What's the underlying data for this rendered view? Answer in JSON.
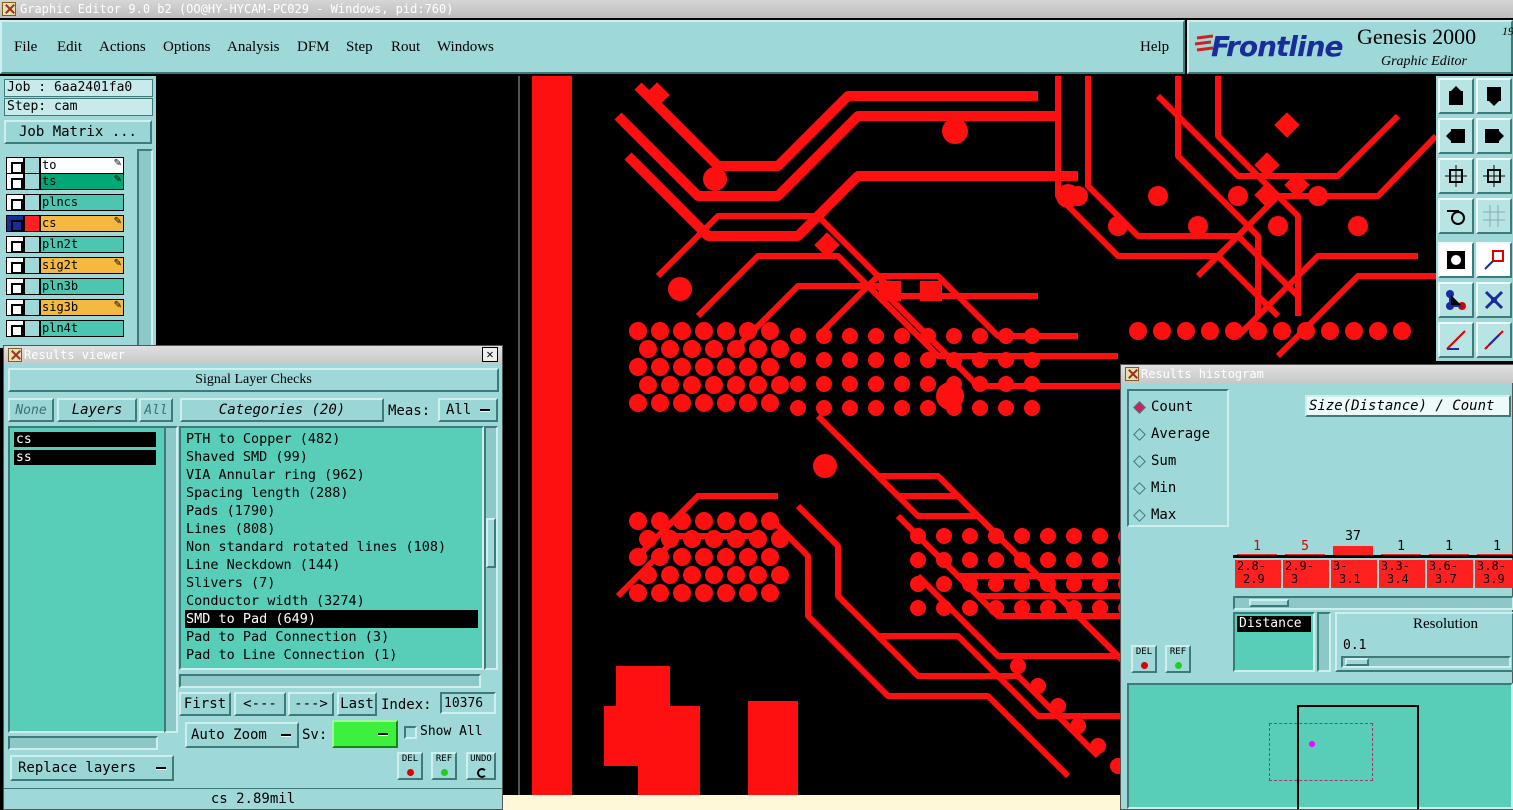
{
  "window": {
    "title": "Graphic Editor 9.0 b2 (OO@HY-HYCAM-PC029 - Windows, pid:760)"
  },
  "menu": [
    "File",
    "Edit",
    "Actions",
    "Options",
    "Analysis",
    "DFM",
    "Step",
    "Rout",
    "Windows"
  ],
  "help": "Help",
  "logo": {
    "brand": "Frontline",
    "product": "Genesis 2000",
    "superscript": "19",
    "subtitle": "Graphic Editor"
  },
  "job": {
    "job_label": "Job : 6aa2401fa0",
    "step_label": "Step: cam",
    "matrix_button": "Job Matrix ..."
  },
  "layers": [
    {
      "name": "to",
      "color": "#ffffff"
    },
    {
      "name": "ts",
      "color": "#00a878"
    },
    {
      "name": "plncs",
      "color": "#4cc6b0"
    },
    {
      "name": "cs",
      "color": "#f5b840"
    },
    {
      "name": "pln2t",
      "color": "#4cc6b0"
    },
    {
      "name": "sig2t",
      "color": "#f5b840"
    },
    {
      "name": "pln3b",
      "color": "#4cc6b0"
    },
    {
      "name": "sig3b",
      "color": "#f5b840"
    },
    {
      "name": "pln4t",
      "color": "#4cc6b0"
    }
  ],
  "results_viewer": {
    "title": "Results viewer",
    "header": "Signal Layer Checks",
    "none_button": "None",
    "layers_button": "Layers",
    "all_button": "All",
    "categories_button": "Categories (20)",
    "meas_label": "Meas:",
    "meas_value": "All",
    "layer_list": [
      "cs",
      "ss"
    ],
    "categories": [
      "PTH to Copper (482)",
      "Shaved SMD (99)",
      "VIA Annular ring (962)",
      "Spacing length (288)",
      "Pads (1790)",
      "Lines (808)",
      "Non standard rotated lines (108)",
      "Line Neckdown (144)",
      "Slivers (7)",
      "Conductor width (3274)",
      "SMD to Pad (649)",
      "Pad to Pad Connection (3)",
      "Pad to Line Connection (1)"
    ],
    "selected_category": "SMD to Pad (649)",
    "nav": {
      "first": "First",
      "prev": "<---",
      "next": "--->",
      "last": "Last",
      "index_label": "Index:",
      "index_value": "10376"
    },
    "auto_zoom": "Auto Zoom",
    "sv_label": "Sv:",
    "show_all": "Show All",
    "replace_layers": "Replace layers",
    "del": "DEL",
    "ref": "REF",
    "undo": "UNDO",
    "status": "cs 2.89mil"
  },
  "histogram": {
    "title": "Results histogram",
    "modes": [
      "Count",
      "Average",
      "Sum",
      "Min",
      "Max"
    ],
    "selected_mode": "Count",
    "axis_label": "Size(Distance) / Count",
    "counts": [
      "1",
      "5",
      "37",
      "1",
      "1",
      "1"
    ],
    "bins_top": [
      "2.8-",
      "2.9-",
      "3-",
      "3.3-",
      "3.6-",
      "3.8-"
    ],
    "bins_bottom": [
      "2.9",
      "3",
      "3.1",
      "3.4",
      "3.7",
      "3.9"
    ],
    "distance_label": "Distance",
    "resolution_label": "Resolution",
    "resolution_value": "0.1",
    "del": "DEL",
    "ref": "REF"
  },
  "colors": {
    "accent": "#9ed8d8",
    "copper": "#ff0000",
    "selection": "#000000"
  }
}
